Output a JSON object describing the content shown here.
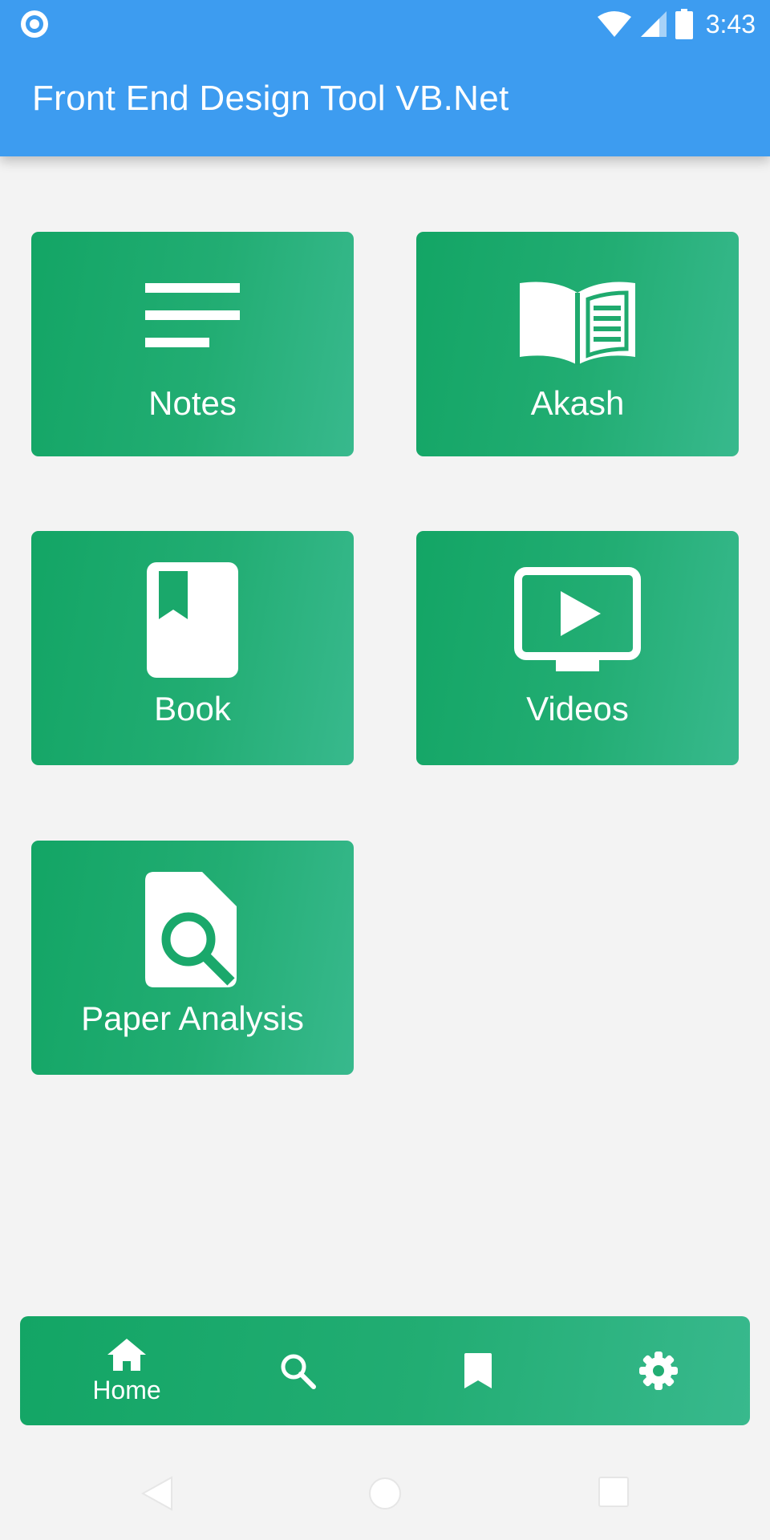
{
  "status_bar": {
    "time": "3:43",
    "icons": [
      "notification-dot-icon",
      "wifi-icon",
      "cell-signal-icon",
      "battery-icon"
    ]
  },
  "app_bar": {
    "title": "Front End Design Tool VB.Net",
    "background_color": "#3d9cf0"
  },
  "tiles": [
    {
      "label": "Notes",
      "icon": "notes-icon"
    },
    {
      "label": "Akash",
      "icon": "open-book-icon"
    },
    {
      "label": "Book",
      "icon": "bookmarked-book-icon"
    },
    {
      "label": "Videos",
      "icon": "video-player-icon"
    },
    {
      "label": "Paper Analysis",
      "icon": "document-search-icon"
    }
  ],
  "bottom_nav": {
    "items": [
      {
        "label": "Home",
        "icon": "home-icon",
        "active": true
      },
      {
        "label": "",
        "icon": "search-icon",
        "active": false
      },
      {
        "label": "",
        "icon": "bookmark-icon",
        "active": false
      },
      {
        "label": "",
        "icon": "settings-icon",
        "active": false
      }
    ]
  },
  "system_nav": [
    "back-icon",
    "home-circle-icon",
    "recents-icon"
  ],
  "colors": {
    "accent_green": "#13a565",
    "accent_green_light": "#38b98d",
    "background": "#f3f3f3"
  }
}
